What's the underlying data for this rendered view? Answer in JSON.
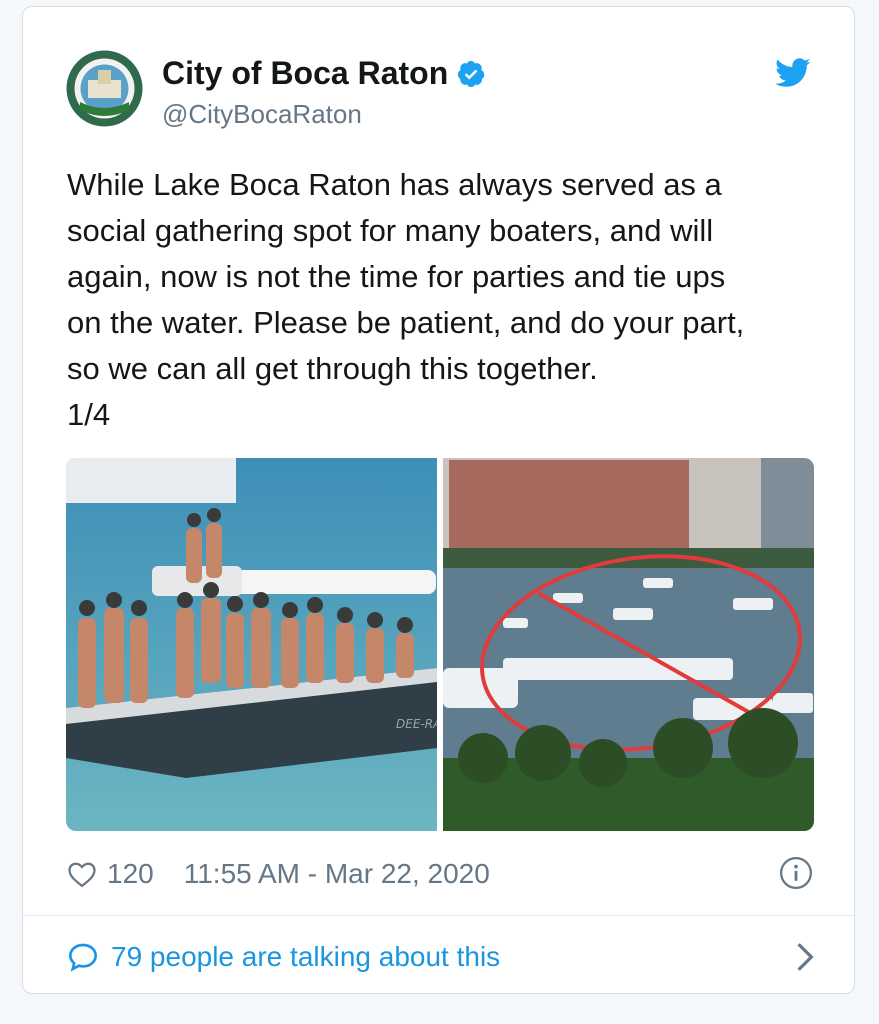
{
  "account": {
    "display_name": "City of Boca Raton",
    "handle": "@CityBocaRaton",
    "verified": true,
    "avatar_icon": "boca-raton-seal-icon"
  },
  "tweet": {
    "lines": [
      "While Lake Boca Raton has always served as a",
      "social gathering spot for many boaters, and will",
      "again, now is not the time for parties and tie ups",
      "on the water. Please be patient, and do your part,",
      "so we can all get through this together.",
      "1/4"
    ]
  },
  "media": {
    "images": [
      {
        "icon": "boaters-party-photo"
      },
      {
        "icon": "boats-on-lake-photo"
      }
    ]
  },
  "meta": {
    "likes": "120",
    "timestamp": "11:55 AM - Mar 22, 2020"
  },
  "footer": {
    "talking": "79 people are talking about this"
  },
  "colors": {
    "link": "#1b95e0",
    "verified": "#1da1f2",
    "text": "#14171a",
    "muted": "#657786"
  }
}
